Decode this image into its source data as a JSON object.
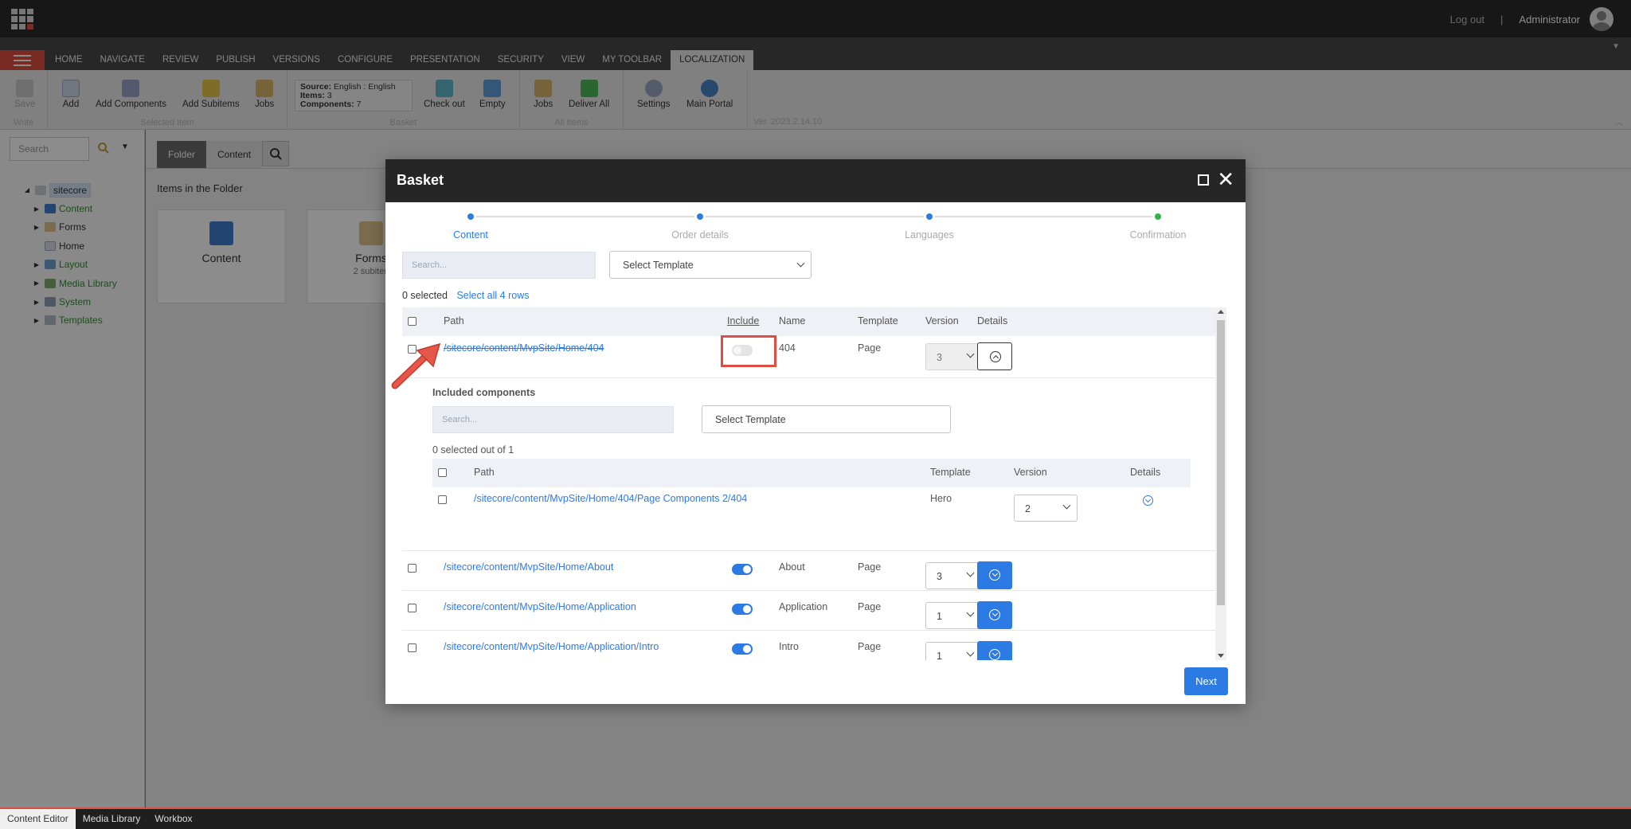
{
  "topbar": {
    "logout": "Log out",
    "separator": "|",
    "user": "Administrator"
  },
  "ribbon_tabs": [
    "HOME",
    "NAVIGATE",
    "REVIEW",
    "PUBLISH",
    "VERSIONS",
    "CONFIGURE",
    "PRESENTATION",
    "SECURITY",
    "VIEW",
    "MY TOOLBAR",
    "LOCALIZATION"
  ],
  "ribbon": {
    "write": {
      "label": "Write",
      "save": "Save"
    },
    "selected_item": {
      "label": "Selected Item",
      "add": "Add",
      "add_components": "Add Components",
      "add_subitems": "Add Subitems",
      "jobs": "Jobs"
    },
    "basket": {
      "label": "Basket",
      "source_label": "Source:",
      "source_value": "English : English",
      "items_label": "Items:",
      "items_value": "3",
      "components_label": "Components:",
      "components_value": "7",
      "check_out": "Check out",
      "empty": "Empty"
    },
    "all_items": {
      "label": "All Items",
      "jobs": "Jobs",
      "deliver_all": "Deliver All"
    },
    "settings": "Settings",
    "main_portal": "Main Portal",
    "version": "Ver. 2023.2.14.10"
  },
  "left_panel": {
    "search_placeholder": "Search",
    "tree": [
      {
        "label": "sitecore"
      },
      {
        "label": "Content"
      },
      {
        "label": "Forms"
      },
      {
        "label": "Home"
      },
      {
        "label": "Layout"
      },
      {
        "label": "Media Library"
      },
      {
        "label": "System"
      },
      {
        "label": "Templates"
      }
    ]
  },
  "main": {
    "tabs": [
      "Folder",
      "Content"
    ],
    "title": "Items in the Folder",
    "cards": [
      {
        "label": "Content",
        "sub": ""
      },
      {
        "label": "Forms",
        "sub": "2 subiten"
      }
    ]
  },
  "bottom_tabs": [
    "Content Editor",
    "Media Library",
    "Workbox"
  ],
  "modal": {
    "title": "Basket",
    "steps": [
      "Content",
      "Order details",
      "Languages",
      "Confirmation"
    ],
    "search_placeholder": "Search...",
    "template_select": "Select Template",
    "selected_count": "0 selected",
    "select_all": "Select all 4 rows",
    "columns": {
      "path": "Path",
      "include": "Include",
      "name": "Name",
      "template": "Template",
      "version": "Version",
      "details": "Details"
    },
    "rows": [
      {
        "path": "/sitecore/content/MvpSite/Home/404",
        "include": false,
        "name": "404",
        "template": "Page",
        "version": "3"
      },
      {
        "path": "/sitecore/content/MvpSite/Home/About",
        "include": true,
        "name": "About",
        "template": "Page",
        "version": "3"
      },
      {
        "path": "/sitecore/content/MvpSite/Home/Application",
        "include": true,
        "name": "Application",
        "template": "Page",
        "version": "1"
      },
      {
        "path": "/sitecore/content/MvpSite/Home/Application/Intro",
        "include": true,
        "name": "Intro",
        "template": "Page",
        "version": "1"
      }
    ],
    "components": {
      "title": "Included components",
      "search_placeholder": "Search...",
      "template_select": "Select Template",
      "selected_info": "0 selected out of 1",
      "columns": {
        "path": "Path",
        "template": "Template",
        "version": "Version",
        "details": "Details"
      },
      "rows": [
        {
          "path": "/sitecore/content/MvpSite/Home/404/Page Components 2/404",
          "template": "Hero",
          "version": "2"
        }
      ]
    },
    "next": "Next"
  },
  "colors": {
    "accent": "#2c7be5",
    "brand_red": "#dc4e41",
    "success": "#2fb344"
  }
}
